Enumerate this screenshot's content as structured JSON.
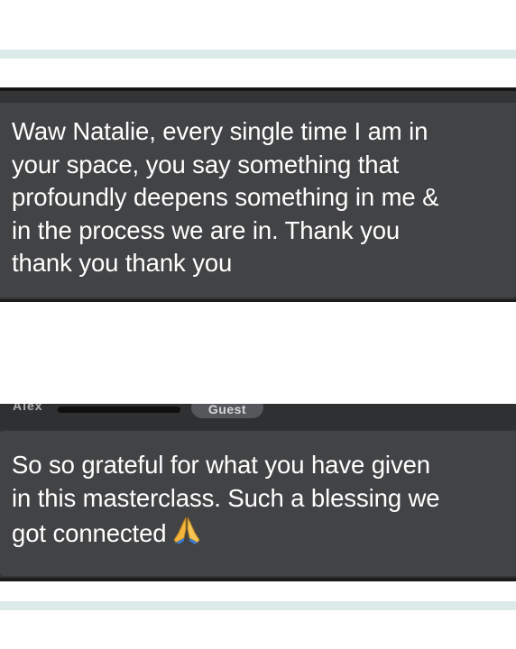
{
  "chat": {
    "messages": [
      {
        "text": "Waw Natalie, every single time I am in\nyour space, you say something that\nprofoundly deepens something in me &\nin the process we are in.  Thank you\nthank you thank you"
      },
      {
        "sender_name": "Alex",
        "badge": "Guest",
        "text": "So so grateful for what you have given\nin this masterclass.  Such a blessing we\ngot connected",
        "emoji": "folded-hands-icon"
      }
    ]
  },
  "colors": {
    "message_background": "#424345",
    "card_background": "#333436",
    "divider": "#dcebe9",
    "text": "#ffffff"
  }
}
